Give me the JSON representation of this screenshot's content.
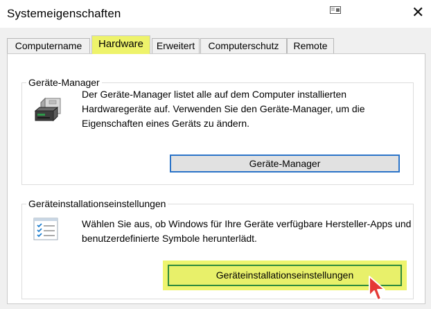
{
  "window": {
    "title": "Systemeigenschaften",
    "help_icon": "window-help-icon",
    "close_icon": "close-icon",
    "close_glyph": "✕"
  },
  "tabs": [
    {
      "label": "Computername",
      "active": false
    },
    {
      "label": "Hardware",
      "active": true
    },
    {
      "label": "Erweitert",
      "active": false
    },
    {
      "label": "Computerschutz",
      "active": false
    },
    {
      "label": "Remote",
      "active": false
    }
  ],
  "device_manager": {
    "group_label": "Geräte-Manager",
    "icon": "device-manager-icon",
    "description": "Der Geräte-Manager listet alle auf dem Computer installierten Hardwaregeräte auf. Verwenden Sie den Geräte-Manager, um die Eigenschaften eines Geräts zu ändern.",
    "button_label": "Geräte-Manager"
  },
  "device_installation": {
    "group_label": "Geräteinstallationseinstellungen",
    "icon": "checklist-icon",
    "description": "Wählen Sie aus, ob Windows für Ihre Geräte verfügbare Hersteller-Apps und benutzerdefinierte Symbole herunterlädt.",
    "button_label": "Geräteinstallationseinstellungen"
  },
  "colors": {
    "highlight": "#eef36b",
    "focus_blue": "#2a73c8",
    "focus_green": "#2d8a3c",
    "cursor_red": "#e53935"
  },
  "pointer": "mouse-cursor-icon"
}
